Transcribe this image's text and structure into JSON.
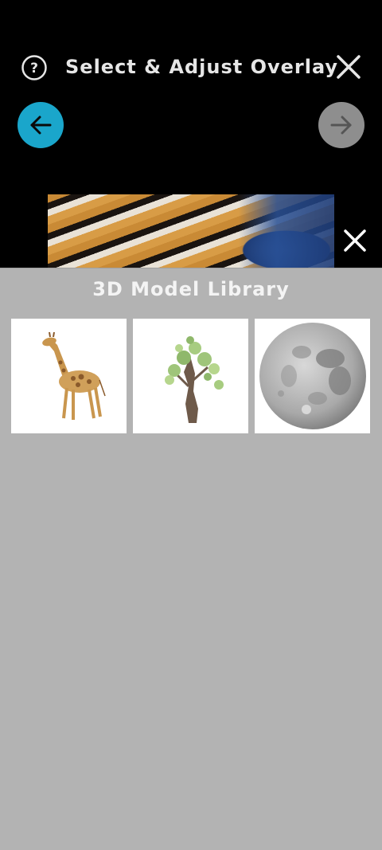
{
  "header": {
    "title": "Select & Adjust Overlay",
    "help_icon": "help-circle-icon",
    "close_icon": "close-icon"
  },
  "nav": {
    "back_icon": "arrow-left-icon",
    "next_icon": "arrow-right-icon",
    "back_color": "#1aa6cb",
    "next_color": "#8e8e8e"
  },
  "overlay_close_icon": "close-icon",
  "library": {
    "title": "3D Model Library",
    "items": [
      {
        "name": "giraffe",
        "icon": "giraffe-thumbnail"
      },
      {
        "name": "tree",
        "icon": "tree-thumbnail"
      },
      {
        "name": "moon",
        "icon": "moon-thumbnail"
      }
    ]
  },
  "colors": {
    "panel_bg": "#b3b3b3",
    "top_bg": "#000000"
  }
}
